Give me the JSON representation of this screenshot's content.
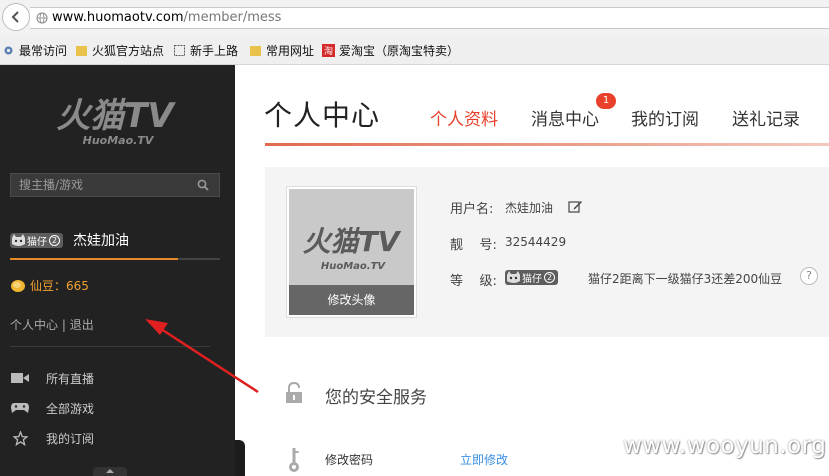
{
  "browser": {
    "url_host": "www.huomaotv.com",
    "url_path": "/member/mess",
    "bookmarks": [
      {
        "label": "最常访问"
      },
      {
        "label": "火狐官方站点"
      },
      {
        "label": "新手上路"
      },
      {
        "label": "常用网址"
      },
      {
        "label": "爱淘宝（原淘宝特卖）"
      }
    ]
  },
  "sidebar": {
    "logo_text": "火猫TV",
    "logo_sub": "HuoMao.TV",
    "search_placeholder": "搜主播/游戏",
    "level_badge": "猫仔",
    "level_num": "2",
    "username": "杰娃加油",
    "coins_label": "仙豆：665",
    "link_center": "个人中心",
    "link_sep": "|",
    "link_logout": "退出",
    "nav": [
      {
        "label": "所有直播",
        "icon": "video-icon"
      },
      {
        "label": "全部游戏",
        "icon": "gamepad-icon"
      },
      {
        "label": "我的订阅",
        "icon": "star-icon"
      }
    ]
  },
  "main": {
    "page_title": "个人中心",
    "tabs": [
      {
        "label": "个人资料",
        "active": true
      },
      {
        "label": "消息中心",
        "active": false
      },
      {
        "label": "我的订阅",
        "active": false
      },
      {
        "label": "送礼记录",
        "active": false
      }
    ],
    "message_badge": "1",
    "avatar_button": "修改头像",
    "avatar_logo": "火猫TV",
    "avatar_logo_sub": "HuoMao.TV",
    "info": {
      "username_label": "用户名:",
      "username_value": "杰娃加油",
      "id_label": "靓    号:",
      "id_value": "32544429",
      "level_label": "等    级:",
      "level_badge": "猫仔",
      "level_num": "2",
      "level_desc": "猫仔2距离下一级猫仔3还差200仙豆",
      "help": "?"
    },
    "security_title": "您的安全服务",
    "password_label": "修改密码",
    "password_link": "立即修改"
  },
  "watermark": "www.wooyun.org",
  "colors": {
    "accent": "#e8402a",
    "sidebar_bg": "#222222",
    "coin": "#f0a030",
    "link": "#3a8ee6"
  }
}
